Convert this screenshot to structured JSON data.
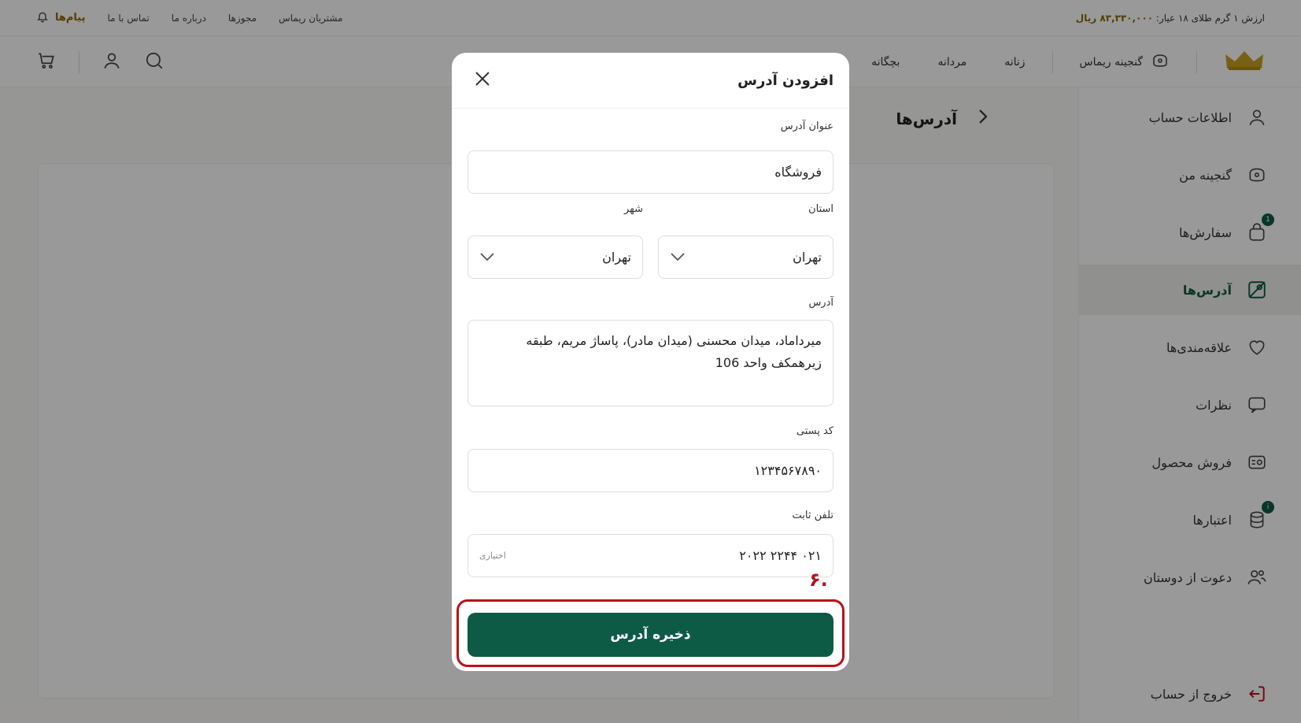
{
  "topbar": {
    "gold_price_label": "ارزش ۱ گرم طلای ۱۸ عیار:",
    "gold_price_value": "۸۳,۳۳۰,۰۰۰ ریال",
    "messages": "پیام‌ها",
    "links": [
      "تماس با ما",
      "درباره ما",
      "مجوزها",
      "مشتریان ریماس"
    ]
  },
  "mainnav": {
    "menu": [
      "بچگانه",
      "مردانه",
      "زنانه"
    ],
    "treasure": "گنجینه ریماس"
  },
  "sidebar": {
    "items": [
      {
        "label": "اطلاعات حساب",
        "icon": "user-icon",
        "badge": ""
      },
      {
        "label": "گنجینه من",
        "icon": "treasure-icon",
        "badge": ""
      },
      {
        "label": "سفارش‌ها",
        "icon": "bag-icon",
        "badge": "1"
      },
      {
        "label": "آدرس‌ها",
        "icon": "map-icon",
        "badge": ""
      },
      {
        "label": "علاقه‌مندی‌ها",
        "icon": "heart-icon",
        "badge": ""
      },
      {
        "label": "نظرات",
        "icon": "comment-icon",
        "badge": ""
      },
      {
        "label": "فروش محصول",
        "icon": "sell-icon",
        "badge": ""
      },
      {
        "label": "اعتبارها",
        "icon": "coins-icon",
        "badge": "i"
      },
      {
        "label": "دعوت از دوستان",
        "icon": "users-icon",
        "badge": ""
      }
    ],
    "logout": "خروج از حساب"
  },
  "page": {
    "title": "آدرس‌ها"
  },
  "modal": {
    "title": "افزودن آدرس",
    "address_title_label": "عنوان آدرس",
    "address_title_value": "فروشگاه",
    "province_label": "استان",
    "province_value": "تهران",
    "city_label": "شهر",
    "city_value": "تهران",
    "address_label": "آدرس",
    "address_value": "میرداماد، میدان محسنی (میدان مادر)، پاساژ مریم، طبقه زیرهمکف واحد 106",
    "postal_label": "کد پستی",
    "postal_value": "۱۲۳۴۵۶۷۸۹۰",
    "phone_label": "تلفن ثابت",
    "phone_value": "۰۲۱ ۲۲۴۴ ۲۰۲۲",
    "phone_optional": "اختیاری",
    "step_marker": ".۶",
    "save_label": "ذخیره آدرس"
  },
  "colors": {
    "primary": "#0e5b45",
    "highlight": "#b6121b",
    "gold": "#c9a227"
  }
}
